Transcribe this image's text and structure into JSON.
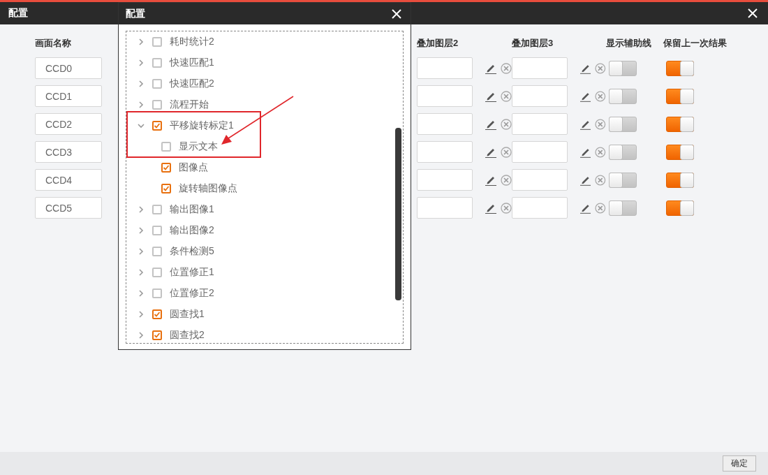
{
  "window": {
    "title": "配置"
  },
  "table": {
    "columns": [
      "画面名称",
      "叠加图层2",
      "叠加图层3",
      "显示辅助线",
      "保留上一次结果"
    ],
    "rows": [
      {
        "name": "CCD0",
        "show_guides": false,
        "keep_last": true
      },
      {
        "name": "CCD1",
        "show_guides": false,
        "keep_last": true
      },
      {
        "name": "CCD2",
        "show_guides": false,
        "keep_last": true
      },
      {
        "name": "CCD3",
        "show_guides": false,
        "keep_last": true
      },
      {
        "name": "CCD4",
        "show_guides": false,
        "keep_last": true
      },
      {
        "name": "CCD5",
        "show_guides": false,
        "keep_last": true
      }
    ]
  },
  "ok_button": "确定",
  "dialog": {
    "title": "配置",
    "tree": [
      {
        "label": "耗时统计2",
        "checked": false,
        "expanded": false
      },
      {
        "label": "快速匹配1",
        "checked": false,
        "expanded": false
      },
      {
        "label": "快速匹配2",
        "checked": false,
        "expanded": false
      },
      {
        "label": "流程开始",
        "checked": false,
        "expanded": false
      },
      {
        "label": "平移旋转标定1",
        "checked": true,
        "expanded": true,
        "children": [
          {
            "label": "显示文本",
            "checked": false
          },
          {
            "label": "图像点",
            "checked": true
          },
          {
            "label": "旋转轴图像点",
            "checked": true
          }
        ]
      },
      {
        "label": "输出图像1",
        "checked": false,
        "expanded": false
      },
      {
        "label": "输出图像2",
        "checked": false,
        "expanded": false
      },
      {
        "label": "条件检测5",
        "checked": false,
        "expanded": false
      },
      {
        "label": "位置修正1",
        "checked": false,
        "expanded": false
      },
      {
        "label": "位置修正2",
        "checked": false,
        "expanded": false
      },
      {
        "label": "圆查找1",
        "checked": true,
        "expanded": false
      },
      {
        "label": "圆查找2",
        "checked": true,
        "expanded": false
      }
    ]
  }
}
